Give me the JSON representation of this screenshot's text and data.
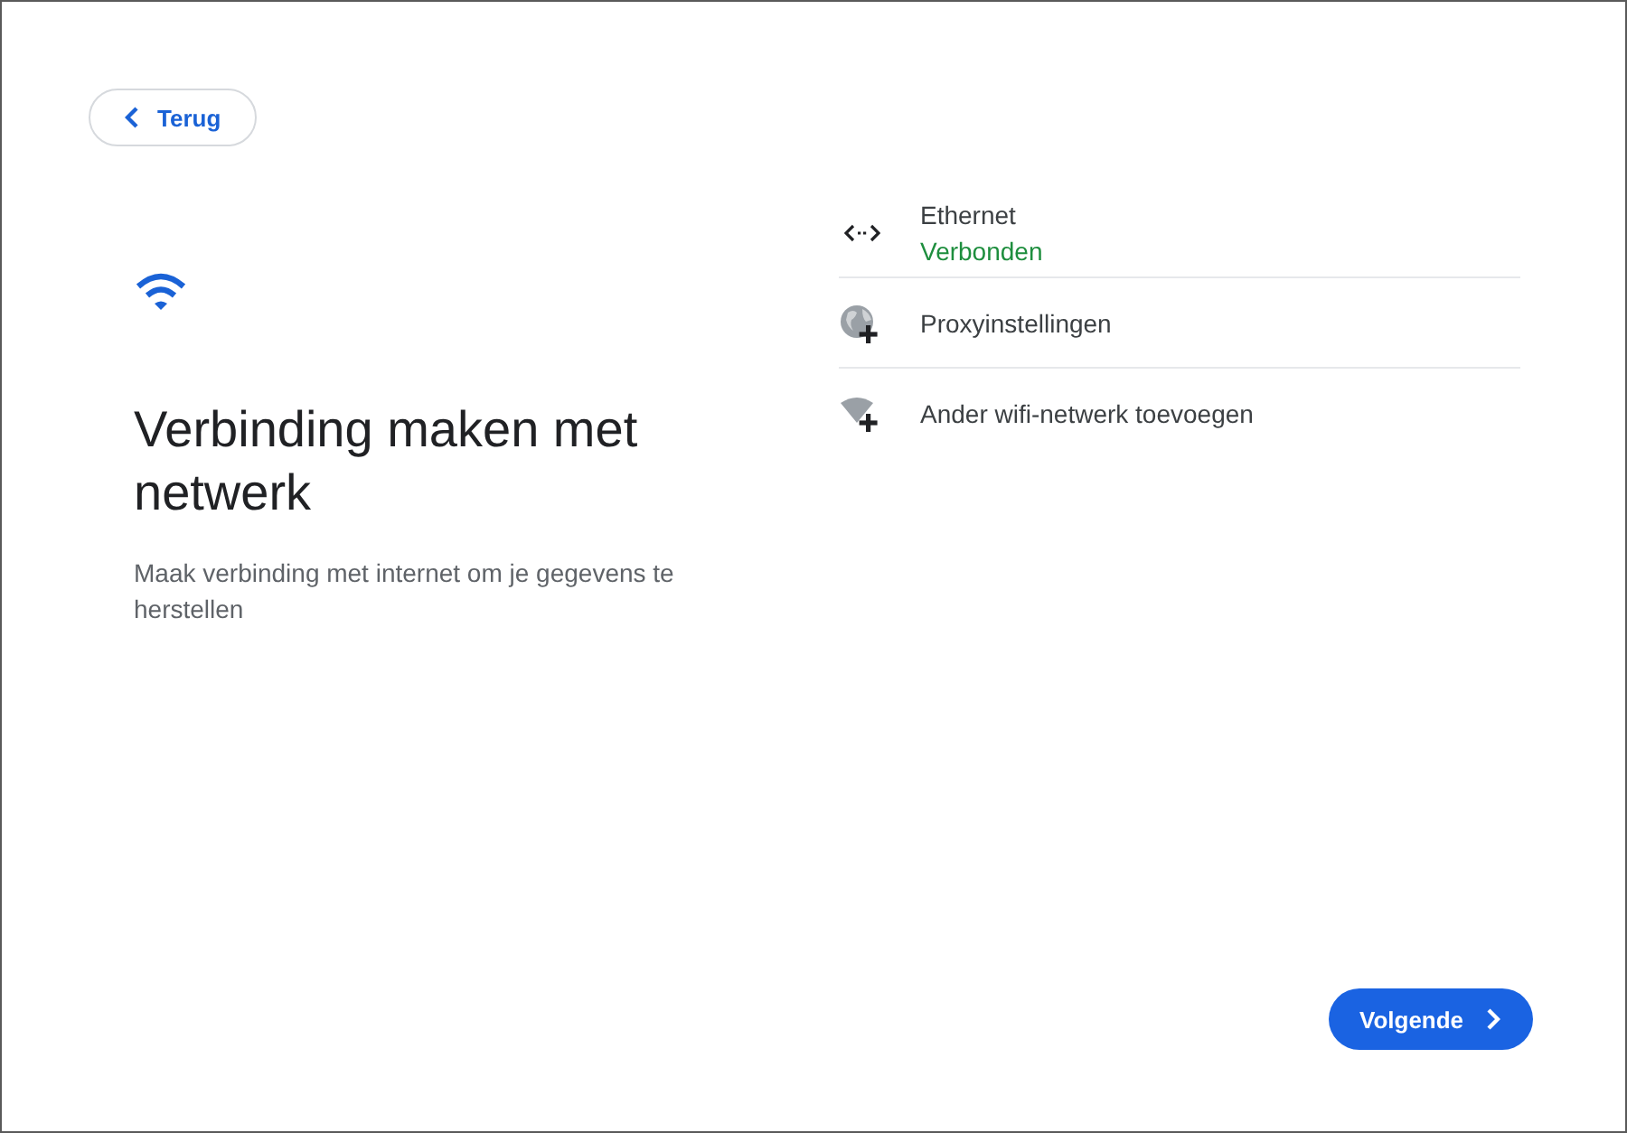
{
  "back_button": {
    "label": "Terug"
  },
  "heading": "Verbinding maken met netwerk",
  "description": "Maak verbinding met internet om je gegevens te herstellen",
  "networks": [
    {
      "kind": "ethernet",
      "name": "Ethernet",
      "status": "Verbonden"
    },
    {
      "kind": "proxy",
      "name": "Proxyinstellingen"
    },
    {
      "kind": "add_wifi",
      "name": "Ander wifi-netwerk toevoegen"
    }
  ],
  "next_button": {
    "label": "Volgende"
  }
}
